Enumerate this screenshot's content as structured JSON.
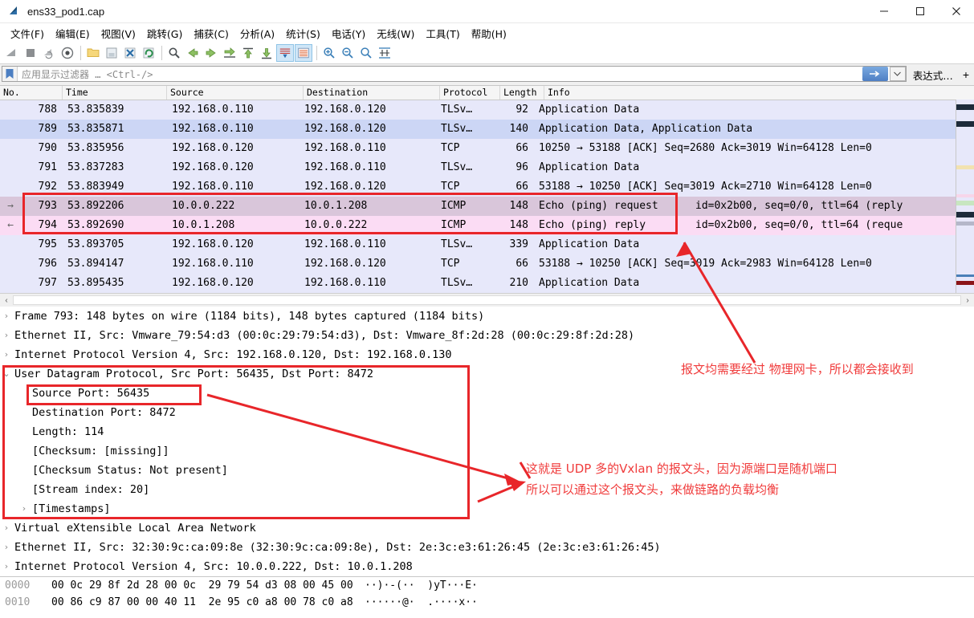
{
  "window": {
    "title": "ens33_pod1.cap",
    "app_icon": "wireshark-fin-icon",
    "minimize": "minimize-icon",
    "maximize": "maximize-icon",
    "close": "close-icon"
  },
  "menu": {
    "items": [
      "文件(F)",
      "编辑(E)",
      "视图(V)",
      "跳转(G)",
      "捕获(C)",
      "分析(A)",
      "统计(S)",
      "电话(Y)",
      "无线(W)",
      "工具(T)",
      "帮助(H)"
    ]
  },
  "toolbar": {
    "icons": [
      "start-capture-icon",
      "stop-capture-icon",
      "restart-capture-icon",
      "capture-options-icon",
      "open-file-icon",
      "save-file-icon",
      "close-file-icon",
      "reload-icon",
      "find-packet-icon",
      "go-back-icon",
      "go-forward-icon",
      "go-to-packet-icon",
      "go-first-packet-icon",
      "go-last-packet-icon",
      "auto-scroll-icon",
      "colorize-icon",
      "zoom-in-icon",
      "zoom-out-icon",
      "zoom-reset-icon",
      "resize-columns-icon"
    ]
  },
  "filter": {
    "bookmark_icon": "bookmark-icon",
    "placeholder": "应用显示过滤器 … <Ctrl-/>",
    "value": "",
    "apply_icon": "arrow-right-icon",
    "dropdown_icon": "chevron-down-icon",
    "expression_label": "表达式…",
    "plus_label": "+"
  },
  "packet_list": {
    "columns": [
      "No.",
      "Time",
      "Source",
      "Destination",
      "Protocol",
      "Length",
      "Info"
    ],
    "rows": [
      {
        "marker": "",
        "no": "788",
        "time": "53.835839",
        "source": "192.168.0.110",
        "destination": "192.168.0.120",
        "protocol": "TLSv…",
        "length": "92",
        "info": "Application Data",
        "info2": "",
        "style": "bg-light"
      },
      {
        "marker": "",
        "no": "789",
        "time": "53.835871",
        "source": "192.168.0.110",
        "destination": "192.168.0.120",
        "protocol": "TLSv…",
        "length": "140",
        "info": "Application Data, Application Data",
        "info2": "",
        "style": "bg-sel"
      },
      {
        "marker": "",
        "no": "790",
        "time": "53.835956",
        "source": "192.168.0.120",
        "destination": "192.168.0.110",
        "protocol": "TCP",
        "length": "66",
        "info": "10250 → 53188 [ACK] Seq=2680 Ack=3019 Win=64128 Len=0",
        "info2": "",
        "style": "bg-light"
      },
      {
        "marker": "",
        "no": "791",
        "time": "53.837283",
        "source": "192.168.0.120",
        "destination": "192.168.0.110",
        "protocol": "TLSv…",
        "length": "96",
        "info": "Application Data",
        "info2": "",
        "style": "bg-light"
      },
      {
        "marker": "",
        "no": "792",
        "time": "53.883949",
        "source": "192.168.0.110",
        "destination": "192.168.0.120",
        "protocol": "TCP",
        "length": "66",
        "info": "53188 → 10250 [ACK] Seq=3019 Ack=2710 Win=64128 Len=0",
        "info2": "",
        "style": "bg-light"
      },
      {
        "marker": "→",
        "no": "793",
        "time": "53.892206",
        "source": "10.0.0.222",
        "destination": "10.0.1.208",
        "protocol": "ICMP",
        "length": "148",
        "info": "Echo (ping) request",
        "info2": "id=0x2b00, seq=0/0, ttl=64 (reply",
        "style": "bg-icmp-a"
      },
      {
        "marker": "←",
        "no": "794",
        "time": "53.892690",
        "source": "10.0.1.208",
        "destination": "10.0.0.222",
        "protocol": "ICMP",
        "length": "148",
        "info": "Echo (ping) reply",
        "info2": "id=0x2b00, seq=0/0, ttl=64 (reque",
        "style": "bg-icmp-b"
      },
      {
        "marker": "",
        "no": "795",
        "time": "53.893705",
        "source": "192.168.0.120",
        "destination": "192.168.0.110",
        "protocol": "TLSv…",
        "length": "339",
        "info": "Application Data",
        "info2": "",
        "style": "bg-light"
      },
      {
        "marker": "",
        "no": "796",
        "time": "53.894147",
        "source": "192.168.0.110",
        "destination": "192.168.0.120",
        "protocol": "TCP",
        "length": "66",
        "info": "53188 → 10250 [ACK] Seq=3019 Ack=2983 Win=64128 Len=0",
        "info2": "",
        "style": "bg-light"
      },
      {
        "marker": "",
        "no": "797",
        "time": "53.895435",
        "source": "192.168.0.120",
        "destination": "192.168.0.110",
        "protocol": "TLSv…",
        "length": "210",
        "info": "Application Data",
        "info2": "",
        "style": "bg-light"
      }
    ]
  },
  "detail": {
    "lines": [
      {
        "twisty": "collapsed",
        "indent": 0,
        "text": "Frame 793: 148 bytes on wire (1184 bits), 148 bytes captured (1184 bits)"
      },
      {
        "twisty": "collapsed",
        "indent": 0,
        "text": "Ethernet II, Src: Vmware_79:54:d3 (00:0c:29:79:54:d3), Dst: Vmware_8f:2d:28 (00:0c:29:8f:2d:28)"
      },
      {
        "twisty": "collapsed",
        "indent": 0,
        "text": "Internet Protocol Version 4, Src: 192.168.0.120, Dst: 192.168.0.130"
      },
      {
        "twisty": "expanded",
        "indent": 0,
        "text": "User Datagram Protocol, Src Port: 56435, Dst Port: 8472"
      },
      {
        "twisty": "none",
        "indent": 1,
        "text": "Source Port: 56435"
      },
      {
        "twisty": "none",
        "indent": 1,
        "text": "Destination Port: 8472"
      },
      {
        "twisty": "none",
        "indent": 1,
        "text": "Length: 114"
      },
      {
        "twisty": "none",
        "indent": 1,
        "text": "[Checksum: [missing]]"
      },
      {
        "twisty": "none",
        "indent": 1,
        "text": "[Checksum Status: Not present]"
      },
      {
        "twisty": "none",
        "indent": 1,
        "text": "[Stream index: 20]"
      },
      {
        "twisty": "collapsed",
        "indent": 1,
        "text": "[Timestamps]"
      },
      {
        "twisty": "collapsed",
        "indent": 0,
        "text": "Virtual eXtensible Local Area Network"
      },
      {
        "twisty": "collapsed",
        "indent": 0,
        "text": "Ethernet II, Src: 32:30:9c:ca:09:8e (32:30:9c:ca:09:8e), Dst: 2e:3c:e3:61:26:45 (2e:3c:e3:61:26:45)"
      },
      {
        "twisty": "collapsed",
        "indent": 0,
        "text": "Internet Protocol Version 4, Src: 10.0.0.222, Dst: 10.0.1.208"
      }
    ]
  },
  "hex": {
    "lines": [
      {
        "offset": "0000",
        "bytes": "00 0c 29 8f 2d 28 00 0c  29 79 54 d3 08 00 45 00",
        "ascii": "··)·-(··  )yT···E·"
      },
      {
        "offset": "0010",
        "bytes": "00 86 c9 87 00 00 40 11  2e 95 c0 a8 00 78 c0 a8",
        "ascii": "······@·  .····x··"
      }
    ]
  },
  "annotations": {
    "color": "#f03c3c",
    "box_color": "#e8262a",
    "note_top": "报文均需要经过 物理网卡，所以都会接收到",
    "note_bottom_line1": "这就是 UDP 多的Vxlan 的报文头，因为源端口是随机端口",
    "note_bottom_line2": "所以可以通过这个报文头，来做链路的负载均衡"
  }
}
